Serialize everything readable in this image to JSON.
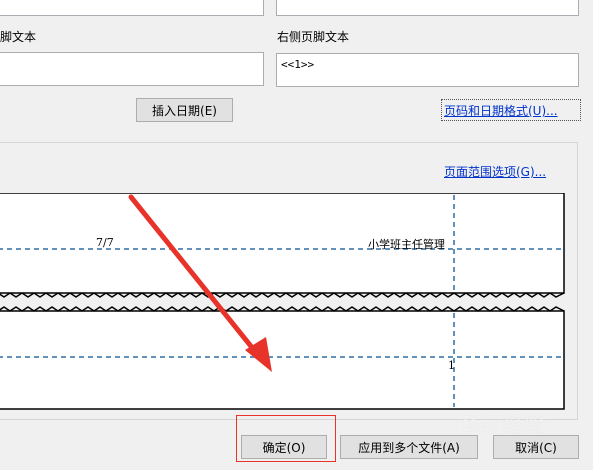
{
  "footer": {
    "left_label": "脚文本",
    "right_label": "右侧页脚文本",
    "right_value": "<<1>>"
  },
  "buttons": {
    "insert_date": "插入日期(E)",
    "ok": "确定(O)",
    "apply_multiple": "应用到多个文件(A)",
    "cancel": "取消(C)"
  },
  "links": {
    "page_date_format": "页码和日期格式(U)...",
    "page_range_options": "页面范围选项(G)..."
  },
  "preview": {
    "page_count": "7/7",
    "header_title": "小学班主任管理",
    "page_number": "1"
  },
  "overlay": {
    "arrow_color": "#e8332a",
    "highlight_color": "#e8332a"
  },
  "watermark": "Bai 经验"
}
